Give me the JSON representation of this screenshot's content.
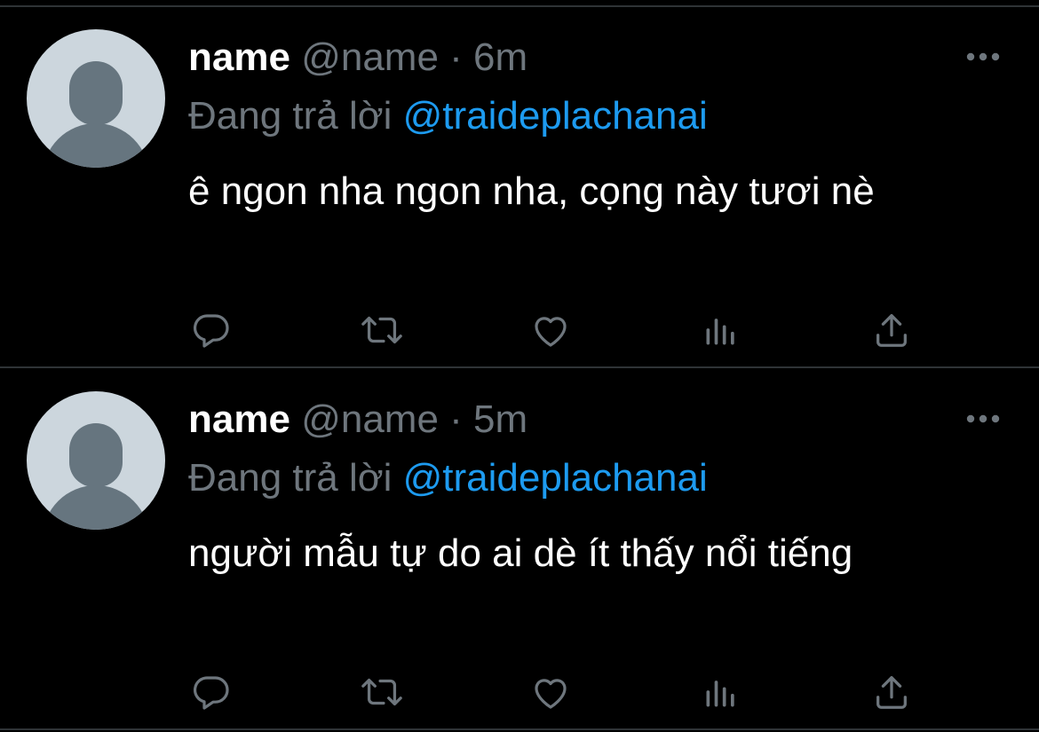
{
  "colors": {
    "background": "#000000",
    "divider": "#2f3336",
    "primary_text": "#ffffff",
    "secondary_text": "#6e767d",
    "link": "#1d9bf0",
    "avatar_bg": "#ccd6dd",
    "avatar_fg": "#66757f"
  },
  "tweets": [
    {
      "display_name": "name",
      "handle": "@name",
      "separator": "·",
      "time": "6m",
      "reply_prefix": "Đang trả lời",
      "reply_to": "@traideplachanai",
      "text": "ê ngon nha ngon nha, cọng này tươi nè",
      "more_icon": "more-horizontal-icon",
      "actions": [
        "reply-icon",
        "retweet-icon",
        "like-icon",
        "views-icon",
        "share-icon"
      ]
    },
    {
      "display_name": "name",
      "handle": "@name",
      "separator": "·",
      "time": "5m",
      "reply_prefix": "Đang trả lời",
      "reply_to": "@traideplachanai",
      "text": "người mẫu tự do ai dè ít thấy nổi tiếng",
      "more_icon": "more-horizontal-icon",
      "actions": [
        "reply-icon",
        "retweet-icon",
        "like-icon",
        "views-icon",
        "share-icon"
      ]
    }
  ]
}
